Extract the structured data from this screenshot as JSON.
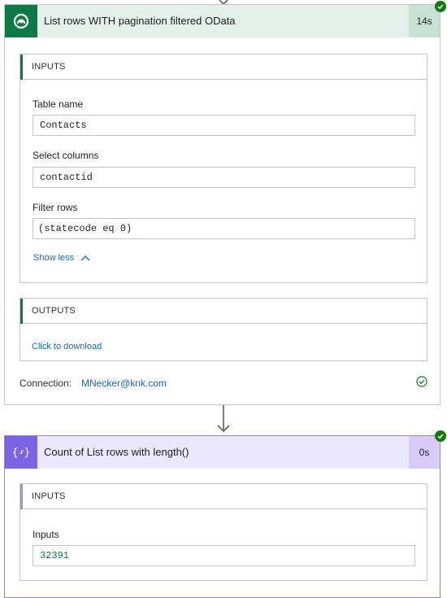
{
  "card1": {
    "title": "List rows WITH pagination filtered OData",
    "duration": "14s",
    "inputs": {
      "header": "INPUTS",
      "fields": [
        {
          "label": "Table name",
          "value": "Contacts"
        },
        {
          "label": "Select columns",
          "value": "contactid"
        },
        {
          "label": "Filter rows",
          "value": "(statecode eq 0)"
        }
      ],
      "show_less": "Show less"
    },
    "outputs": {
      "header": "OUTPUTS",
      "download_link": "Click to download"
    },
    "connection": {
      "label": "Connection:",
      "value": "MNecker@knk.com"
    }
  },
  "card2": {
    "title": "Count of List rows with length()",
    "duration": "0s",
    "inputs": {
      "header": "INPUTS",
      "label": "Inputs",
      "value": "32391"
    }
  },
  "colors": {
    "dataverse_header": "#e3f1ea",
    "dataverse_icon": "#0e7a43",
    "dataverse_duration": "#c6e2d3",
    "expression_header": "#ebe7fc",
    "expression_icon": "#7b63e6",
    "expression_duration": "#d6ccf7",
    "success": "#107c10",
    "link": "#0f6cbd"
  },
  "icons": [
    "dataverse-icon",
    "expression-icon",
    "success-check-icon",
    "chevron-up-icon",
    "arrow-down-icon"
  ]
}
